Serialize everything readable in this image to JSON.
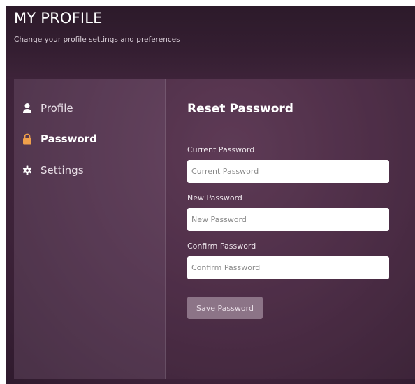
{
  "header": {
    "title": "MY PROFILE",
    "subtitle": "Change your profile settings and preferences"
  },
  "sidebar": {
    "items": [
      {
        "label": "Profile",
        "icon": "user-icon",
        "active": false
      },
      {
        "label": "Password",
        "icon": "lock-icon",
        "active": true
      },
      {
        "label": "Settings",
        "icon": "gear-icon",
        "active": false
      }
    ]
  },
  "form": {
    "title": "Reset Password",
    "fields": [
      {
        "label": "Current Password",
        "placeholder": "Current Password",
        "value": ""
      },
      {
        "label": "New Password",
        "placeholder": "New Password",
        "value": ""
      },
      {
        "label": "Confirm Password",
        "placeholder": "Confirm Password",
        "value": ""
      }
    ],
    "submit_label": "Save Password"
  },
  "colors": {
    "accent_active_icon": "#f0a04b",
    "button_bg": "#8c7487",
    "text_primary": "#ffffff"
  }
}
